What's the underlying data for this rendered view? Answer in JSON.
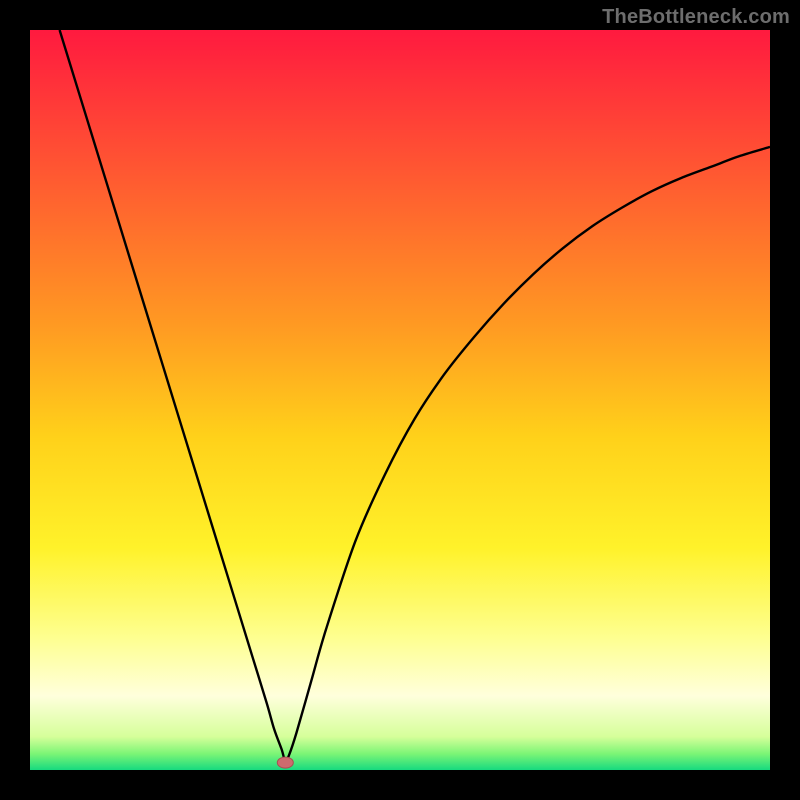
{
  "watermark": "TheBottleneck.com",
  "colors": {
    "frame": "#000000",
    "curve": "#000000",
    "marker_fill": "#cd6b6e",
    "marker_stroke": "#a84f52",
    "gradient_stops": [
      {
        "offset": 0.0,
        "color": "#ff1a3f"
      },
      {
        "offset": 0.2,
        "color": "#ff5a31"
      },
      {
        "offset": 0.4,
        "color": "#ff9a22"
      },
      {
        "offset": 0.55,
        "color": "#ffd11a"
      },
      {
        "offset": 0.7,
        "color": "#fff22a"
      },
      {
        "offset": 0.82,
        "color": "#feff8f"
      },
      {
        "offset": 0.9,
        "color": "#ffffdc"
      },
      {
        "offset": 0.955,
        "color": "#d6ff9a"
      },
      {
        "offset": 0.978,
        "color": "#7cf576"
      },
      {
        "offset": 1.0,
        "color": "#17da7f"
      }
    ]
  },
  "chart_data": {
    "type": "line",
    "title": "",
    "xlabel": "",
    "ylabel": "",
    "xlim": [
      0,
      100
    ],
    "ylim": [
      0,
      100
    ],
    "grid": false,
    "legend": false,
    "marker": {
      "x": 34.5,
      "y": 1.0
    },
    "series": [
      {
        "name": "curve",
        "x": [
          4,
          8,
          12,
          16,
          20,
          24,
          28,
          30,
          32,
          33,
          34,
          34.5,
          35,
          36,
          38,
          40,
          44,
          48,
          52,
          56,
          60,
          64,
          68,
          72,
          76,
          80,
          84,
          88,
          92,
          96,
          100
        ],
        "y": [
          100,
          87,
          74,
          61,
          48,
          35,
          22,
          15.5,
          9,
          5.5,
          2.8,
          1.2,
          2.0,
          5.0,
          12,
          19,
          31,
          40,
          47.5,
          53.5,
          58.5,
          63,
          67,
          70.5,
          73.5,
          76,
          78.2,
          80,
          81.5,
          83,
          84.2
        ]
      }
    ]
  }
}
